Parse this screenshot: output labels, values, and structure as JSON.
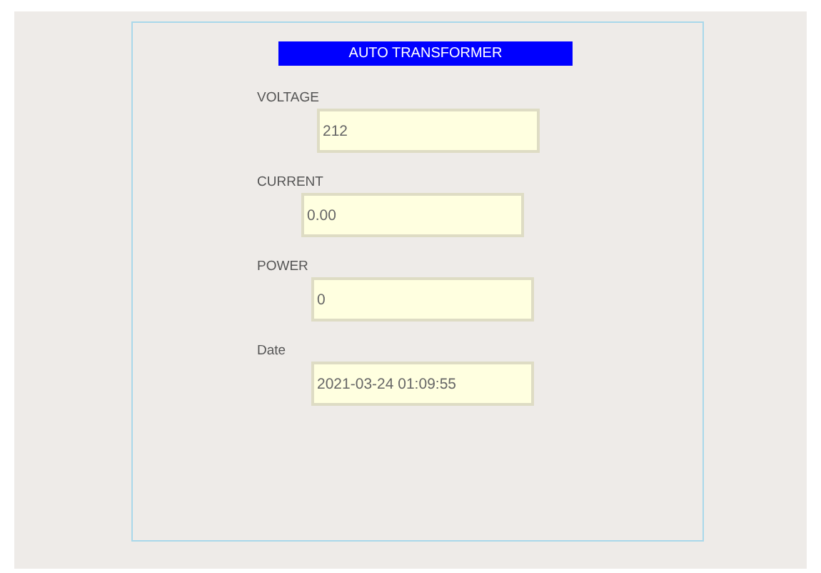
{
  "title": "AUTO TRANSFORMER",
  "fields": [
    {
      "label": "VOLTAGE",
      "value": "212"
    },
    {
      "label": "CURRENT",
      "value": "0.00"
    },
    {
      "label": "POWER",
      "value": "0"
    },
    {
      "label": "Date",
      "value": "2021-03-24 01:09:55"
    }
  ]
}
